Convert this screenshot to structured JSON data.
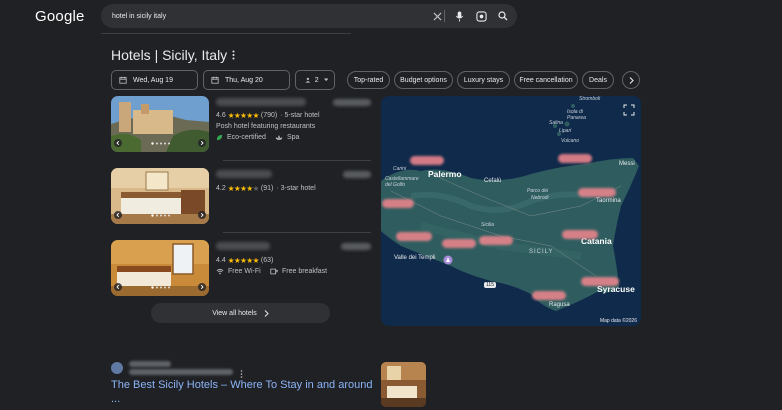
{
  "header": {
    "logo": "Google",
    "search_value": "hotel in sicily italy"
  },
  "hotels_panel": {
    "title": "Hotels | Sicily, Italy",
    "check_in": "Wed, Aug 19",
    "check_out": "Thu, Aug 20",
    "guests": "2",
    "chips": [
      "Top-rated",
      "Budget options",
      "Luxury stays",
      "Free cancellation",
      "Deals"
    ],
    "hotels": [
      {
        "rating": "4.6",
        "reviews": "(790)",
        "class": "· 5-star hotel",
        "description": "Posh hotel featuring restaurants",
        "amenities": [
          "Eco-certified",
          "Spa"
        ]
      },
      {
        "rating": "4.2",
        "reviews": "(91)",
        "class": "· 3-star hotel",
        "description": "",
        "amenities": []
      },
      {
        "rating": "4.4",
        "reviews": "(63)",
        "class": "",
        "description": "",
        "amenities": [
          "Free Wi-Fi",
          "Free breakfast"
        ]
      }
    ],
    "view_all": "View all hotels"
  },
  "map": {
    "labels": {
      "palermo": "Palermo",
      "catania": "Catania",
      "siracuse": "Syracuse",
      "messina": "Messi",
      "taormina": "Taormina",
      "cefalu": "Cefalù",
      "stromboli": "Stromboli",
      "isola": "Isola di",
      "panarea": "Panarea",
      "salina": "Salina",
      "lipari": "Lipari",
      "vulcano": "Vulcano",
      "carini": "Carini",
      "castellammare": "Castellammare",
      "golfo": "del Golfo",
      "parco": "Parco dei",
      "nebrodi": "Nebrodi",
      "sicilia": "Sicilia",
      "sicily": "SICILY",
      "valle": "Valle dei Templi",
      "ragusa": "Ragusa"
    },
    "map_data": "Map data ©2026"
  },
  "result": {
    "title": "The Best Sicily Hotels – Where To Stay in and around",
    "title_cont": "..."
  },
  "colors": {
    "background": "#202124",
    "link": "#8ab4f8",
    "star": "#fbbc04",
    "sea": "#0f2a4a",
    "land": "#2f5d5f"
  }
}
